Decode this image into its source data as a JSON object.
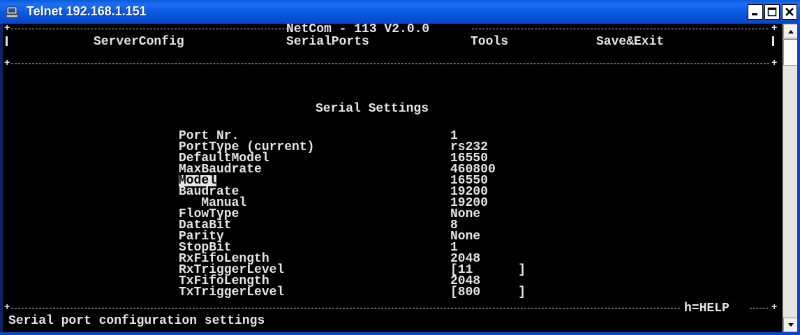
{
  "window": {
    "title": "Telnet 192.168.1.151"
  },
  "header": {
    "app_title": "NetCom - 113 V2.0.0"
  },
  "menu": {
    "items": [
      {
        "label": "ServerConfig"
      },
      {
        "label": "SerialPorts"
      },
      {
        "label": "Tools"
      },
      {
        "label": "Save&Exit"
      }
    ]
  },
  "section": {
    "title": "Serial Settings"
  },
  "settings": [
    {
      "label": "Port Nr.",
      "value": "1"
    },
    {
      "label": "PortType (current)",
      "value": "rs232"
    },
    {
      "label": "DefaultModel",
      "value": "16550"
    },
    {
      "label": "MaxBaudrate",
      "value": "460800"
    },
    {
      "label": "Model",
      "value": "16550",
      "selected": true
    },
    {
      "label": "Baudrate",
      "value": "19200"
    },
    {
      "label": "   Manual",
      "value": "19200"
    },
    {
      "label": "FlowType",
      "value": "None"
    },
    {
      "label": "DataBit",
      "value": "8"
    },
    {
      "label": "Parity",
      "value": "None"
    },
    {
      "label": "StopBit",
      "value": "1"
    },
    {
      "label": "RxFifoLength",
      "value": "2048"
    },
    {
      "label": "RxTriggerLevel",
      "value": "[11      ]"
    },
    {
      "label": "TxFifoLength",
      "value": "2048"
    },
    {
      "label": "TxTriggerLevel",
      "value": "[800     ]"
    }
  ],
  "footer": {
    "help_hint": "h=HELP",
    "status_text": "Serial port configuration settings"
  },
  "colors": {
    "titlebar": "#0b58e0",
    "terminal_bg": "#000000",
    "terminal_fg": "#e6e6e6"
  }
}
